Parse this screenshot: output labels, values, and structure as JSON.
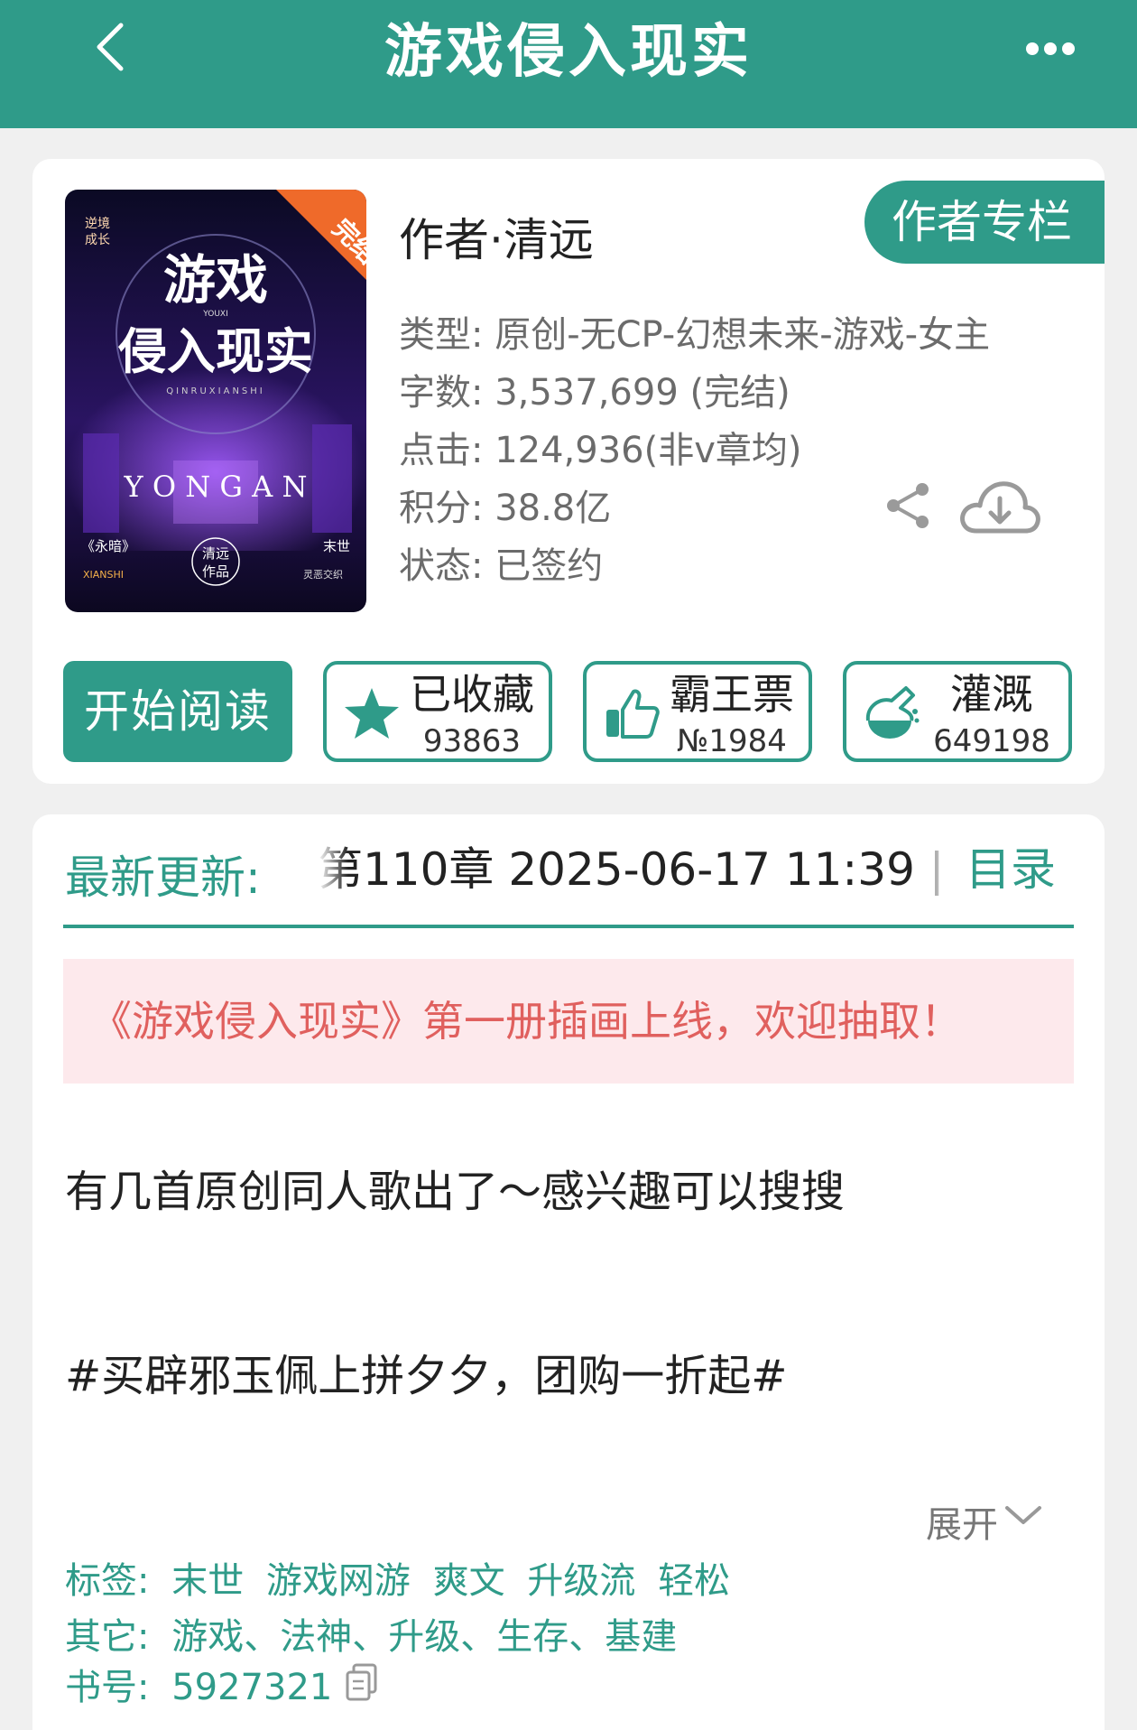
{
  "header": {
    "title": "游戏侵入现实"
  },
  "book": {
    "cover": {
      "badge": "完结",
      "corner_tag_1": "逆境",
      "corner_tag_2": "成长",
      "title_line1": "游戏",
      "title_line2": "侵入现实",
      "pinyin_small": "YOUXI",
      "pinyin_sub": "QINRUXIANSHI",
      "band": "Y O N G A N",
      "footer_left_title": "《永暗》",
      "footer_left_sub": "XIANSHI",
      "footer_center_1": "清远",
      "footer_center_2": "作品",
      "footer_right_title": "末世",
      "footer_right_sub": "灵恶交织"
    },
    "author": "作者·清远",
    "author_column_button": "作者专栏",
    "meta": {
      "type": "类型: 原创-无CP-幻想未来-游戏-女主",
      "words": "字数: 3,537,699 (完结)",
      "clicks": "点击: 124,936(非v章均)",
      "points": "积分: 38.8亿",
      "status": "状态: 已签约"
    }
  },
  "actions": {
    "read_button": "开始阅读",
    "favorite": {
      "label": "已收藏",
      "value": "93863"
    },
    "ticket": {
      "label": "霸王票",
      "value": "№1984"
    },
    "irrigate": {
      "label": "灌溉",
      "value": "649198"
    }
  },
  "latest": {
    "label": "最新更新:",
    "text": "第110章  2025-06-17 11:39 | ",
    "toc_link": "目录"
  },
  "notice": "《游戏侵入现实》第一册插画上线，欢迎抽取！",
  "description": {
    "line1": "有几首原创同人歌出了～感兴趣可以搜搜",
    "line2": "#买辟邪玉佩上拼夕夕，团购一折起#",
    "expand_label": "展开"
  },
  "tags": {
    "label": "标签:",
    "items": [
      "末世",
      "游戏网游",
      "爽文",
      "升级流",
      "轻松"
    ],
    "other_label": "其它:",
    "other_text": "游戏、法神、升级、生存、基建",
    "book_no_label": "书号:",
    "book_no": "5927321"
  },
  "colors": {
    "accent": "#2f9b89",
    "notice_bg": "#fde9ec",
    "notice_text": "#e0605e",
    "icons": [
      "back-icon",
      "more-icon",
      "share-icon",
      "download-icon",
      "star-icon",
      "thumbs-up-icon",
      "flask-icon",
      "chevron-down-icon",
      "copy-icon"
    ]
  }
}
